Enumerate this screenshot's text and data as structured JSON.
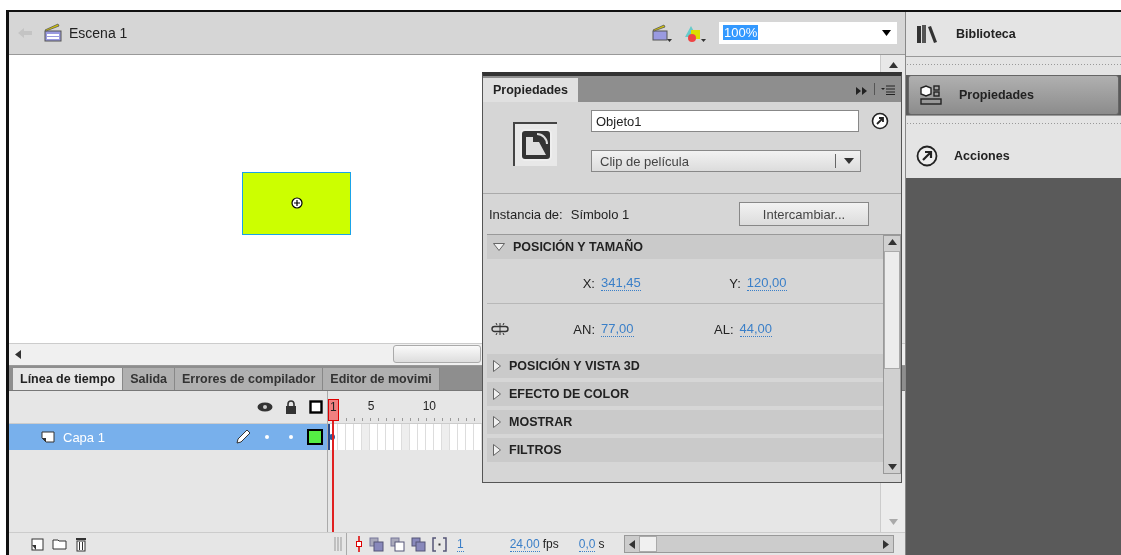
{
  "scene": {
    "title": "Escena 1",
    "zoom": "100%"
  },
  "timeline": {
    "tabs": [
      {
        "label": "Línea de tiempo",
        "selected": true
      },
      {
        "label": "Salida",
        "selected": false
      },
      {
        "label": "Errores de compilador",
        "selected": false
      },
      {
        "label": "Editor de movimi",
        "selected": false
      }
    ],
    "frame_numbers": [
      "1",
      "5",
      "10"
    ],
    "layers": [
      {
        "name": "Capa 1",
        "selected": true
      }
    ],
    "status": {
      "current_frame": "1",
      "fps": "24,00",
      "fps_unit": "fps",
      "time": "0,0",
      "time_unit": "s"
    }
  },
  "properties_panel": {
    "tab": "Propiedades",
    "instance_name": "Objeto1",
    "symbol_type": "Clip de película",
    "instance_label": "Instancia de:",
    "instance_of": "Símbolo 1",
    "swap_button": "Intercambiar...",
    "sections": [
      {
        "title": "POSICIÓN Y TAMAÑO",
        "expanded": true,
        "rows": [
          {
            "linked": false,
            "fields": [
              {
                "label": "X:",
                "value": "341,45"
              },
              {
                "label": "Y:",
                "value": "120,00"
              }
            ]
          },
          {
            "linked": true,
            "fields": [
              {
                "label": "AN:",
                "value": "77,00"
              },
              {
                "label": "AL:",
                "value": "44,00"
              }
            ]
          }
        ]
      },
      {
        "title": "POSICIÓN Y VISTA 3D",
        "expanded": false
      },
      {
        "title": "EFECTO DE COLOR",
        "expanded": false
      },
      {
        "title": "MOSTRAR",
        "expanded": false
      },
      {
        "title": "FILTROS",
        "expanded": false
      }
    ]
  },
  "dock": {
    "items": [
      {
        "kind": "library",
        "label": "Biblioteca",
        "selected": false
      },
      {
        "kind": "properties",
        "label": "Propiedades",
        "selected": true
      },
      {
        "kind": "actions",
        "label": "Acciones",
        "selected": false
      }
    ]
  }
}
